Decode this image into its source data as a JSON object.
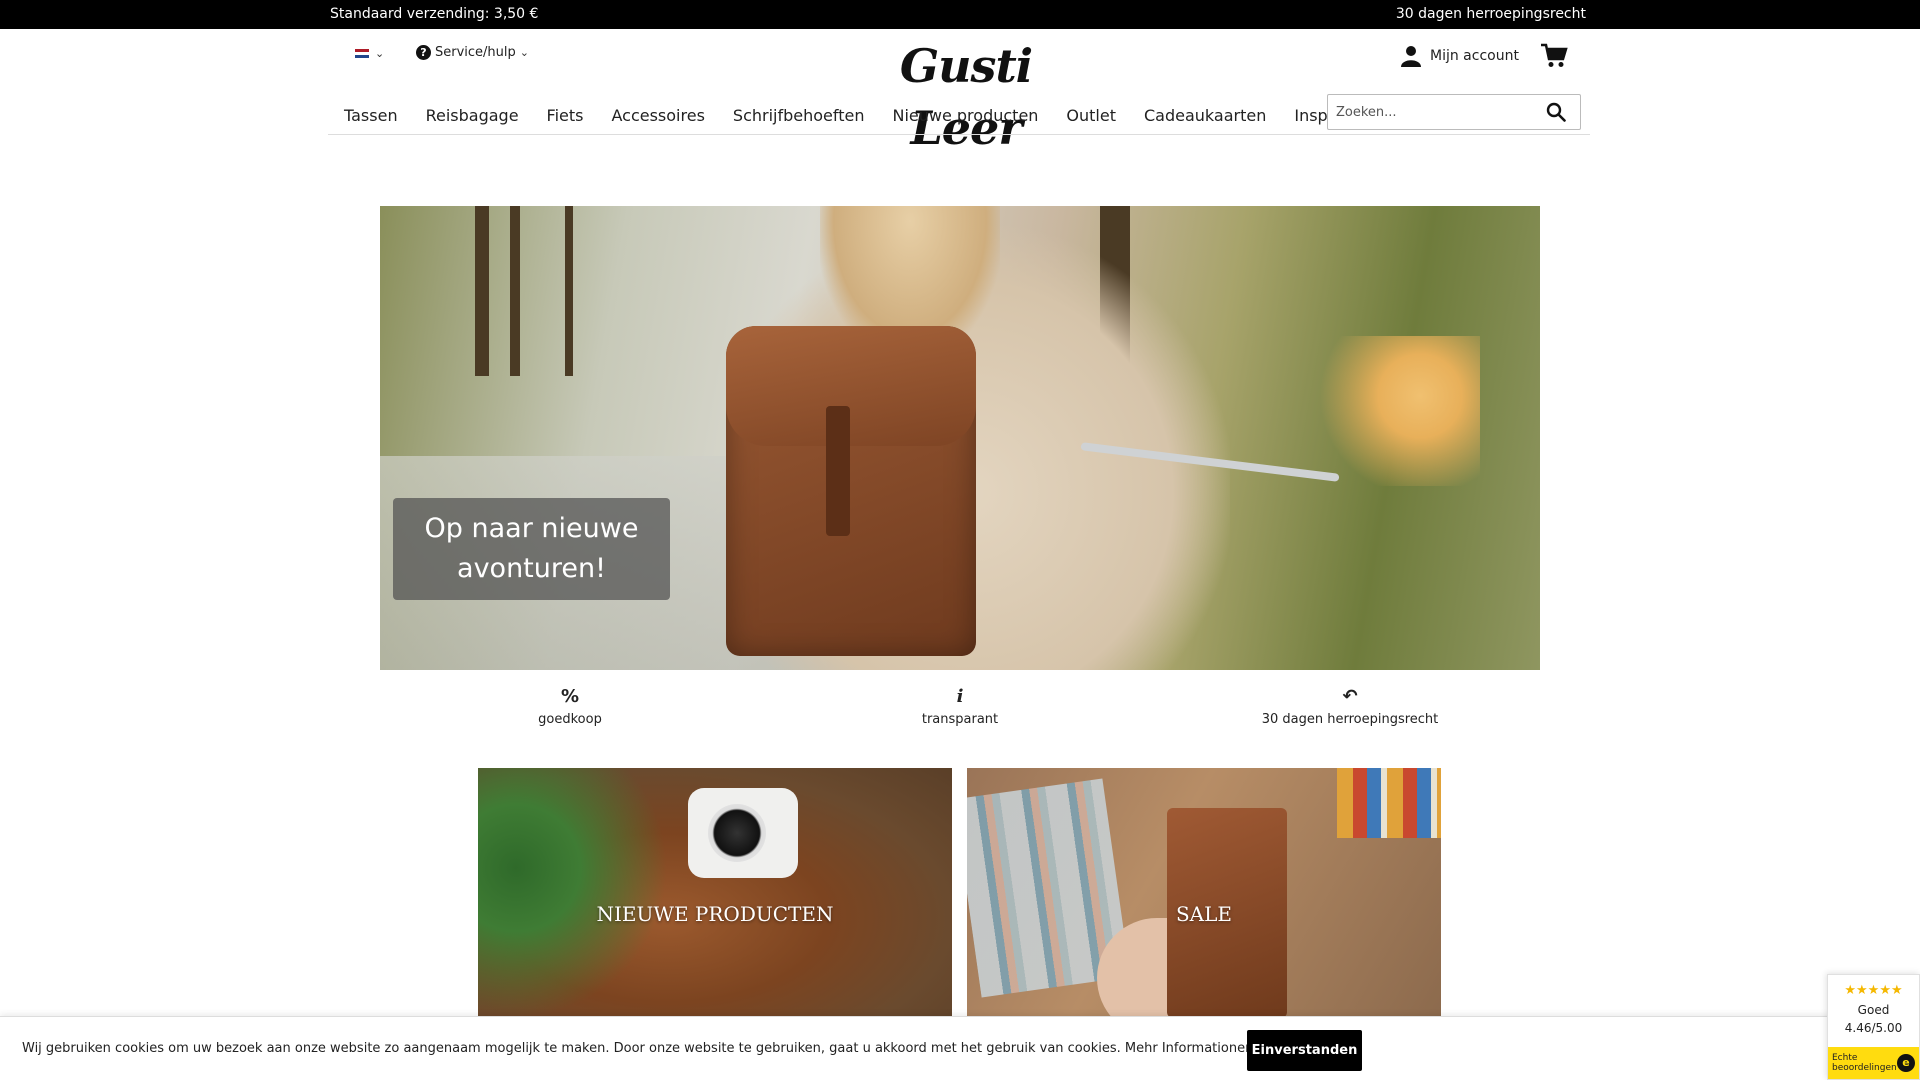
{
  "topbar": {
    "shipping": "Standaard verzending: 3,50 €",
    "returns": "30 dagen herroepingsrecht"
  },
  "header": {
    "service_label": "Service/hulp",
    "logo_text": "Gusti Leer",
    "account_label": "Mijn account",
    "search_placeholder": "Zoeken..."
  },
  "nav": {
    "items": [
      {
        "label": "Tassen"
      },
      {
        "label": "Reisbagage"
      },
      {
        "label": "Fiets"
      },
      {
        "label": "Accessoires"
      },
      {
        "label": "Schrijfbehoeften"
      },
      {
        "label": "Nieuwe producten"
      },
      {
        "label": "Outlet"
      },
      {
        "label": "Cadeaukaarten"
      },
      {
        "label": "Inspiratie"
      }
    ]
  },
  "hero": {
    "caption_line1": "Op naar nieuwe",
    "caption_line2": "avonturen!"
  },
  "usps": [
    {
      "icon": "%",
      "label": "goedkoop"
    },
    {
      "icon": "i",
      "label": "transparant"
    },
    {
      "icon": "↶",
      "label": "30 dagen herroepingsrecht"
    }
  ],
  "tiles": [
    {
      "label": "NIEUWE PRODUCTEN"
    },
    {
      "label": "SALE"
    }
  ],
  "cookie": {
    "message": "Wij gebruiken cookies om uw bezoek aan onze website zo aangenaam mogelijk te maken. Door onze website te gebruiken, gaat u akkoord met het gebruik van cookies.",
    "more_link": "Mehr Informationen",
    "accept_label": "Einverstanden"
  },
  "rating": {
    "stars": "★★★★★",
    "grade": "Goed",
    "score": "4.46/5.00",
    "badge_line1": "Echte",
    "badge_line2": "beoordelingen"
  },
  "colors": {
    "topbar_bg": "#000000",
    "button_bg": "#000000",
    "rating_yellow": "#ffdc0f",
    "star_color": "#f5b800"
  }
}
